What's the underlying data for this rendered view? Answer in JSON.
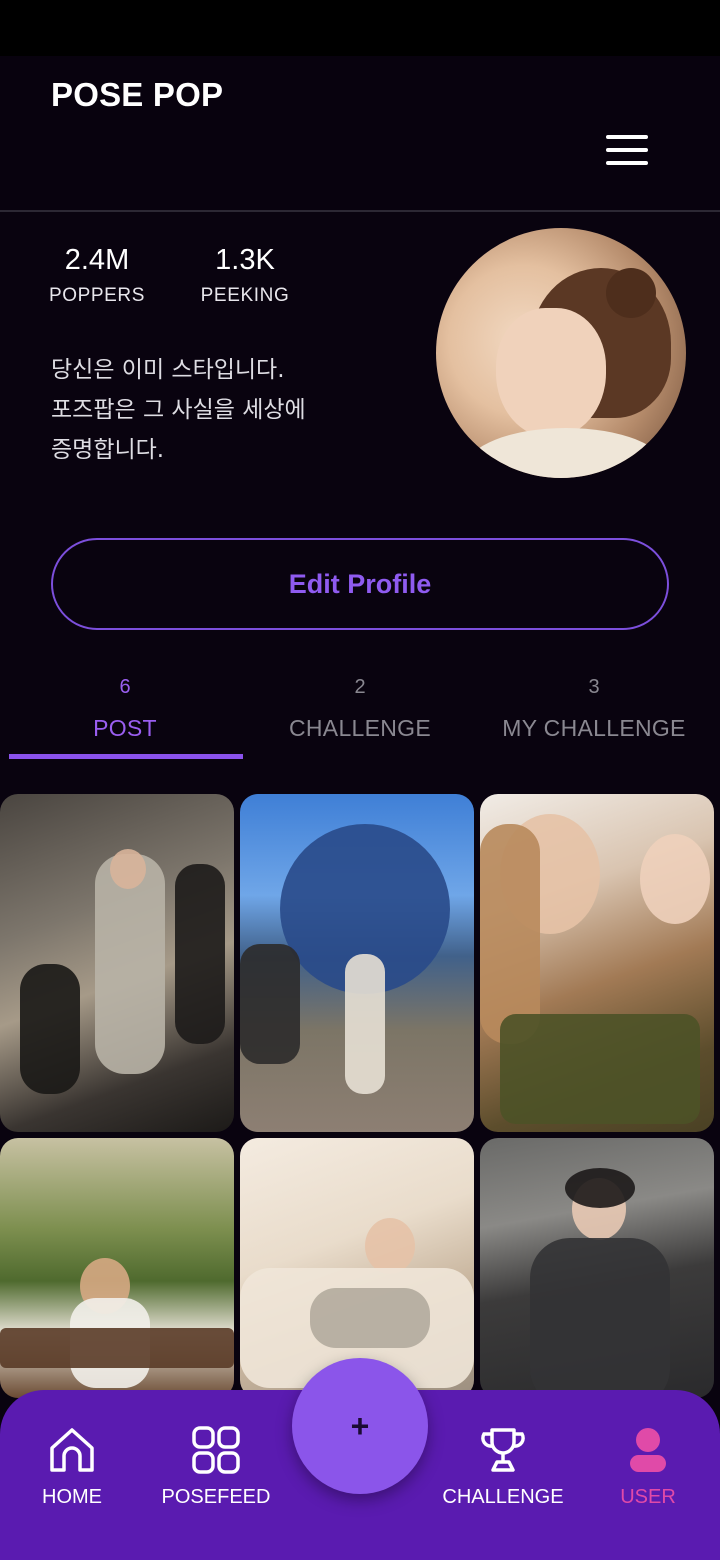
{
  "app": {
    "title": "POSE POP"
  },
  "header": {
    "menu_icon": "hamburger-menu-icon"
  },
  "profile": {
    "stats": [
      {
        "value": "2.4M",
        "label": "POPPERS"
      },
      {
        "value": "1.3K",
        "label": "PEEKING"
      }
    ],
    "bio_lines": [
      "당신은 이미 스타입니다.",
      "포즈팝은 그 사실을 세상에",
      "증명합니다."
    ],
    "edit_button_label": "Edit Profile"
  },
  "tabs": [
    {
      "count": "6",
      "label": "POST",
      "active": true
    },
    {
      "count": "2",
      "label": "CHALLENGE",
      "active": false
    },
    {
      "count": "3",
      "label": "MY CHALLENGE",
      "active": false
    }
  ],
  "posts": [
    {
      "icon": "photo-backstage-fashion"
    },
    {
      "icon": "photo-universal-globe"
    },
    {
      "icon": "photo-doll-with-book"
    },
    {
      "icon": "photo-park-bench-headphones"
    },
    {
      "icon": "photo-sofa-drawing"
    },
    {
      "icon": "photo-studio-portrait"
    }
  ],
  "bottom_nav": {
    "items": [
      {
        "label": "HOME",
        "icon": "home-icon"
      },
      {
        "label": "POSEFEED",
        "icon": "grid-icon"
      },
      {
        "label": "CHALLENGE",
        "icon": "trophy-icon"
      },
      {
        "label": "USER",
        "icon": "user-icon",
        "active": true
      }
    ],
    "fab_label": "+"
  },
  "colors": {
    "background": "#09030f",
    "accent": "#8f5bf0",
    "nav_bar": "#5a1bb0",
    "active_user": "#e04aa8"
  }
}
